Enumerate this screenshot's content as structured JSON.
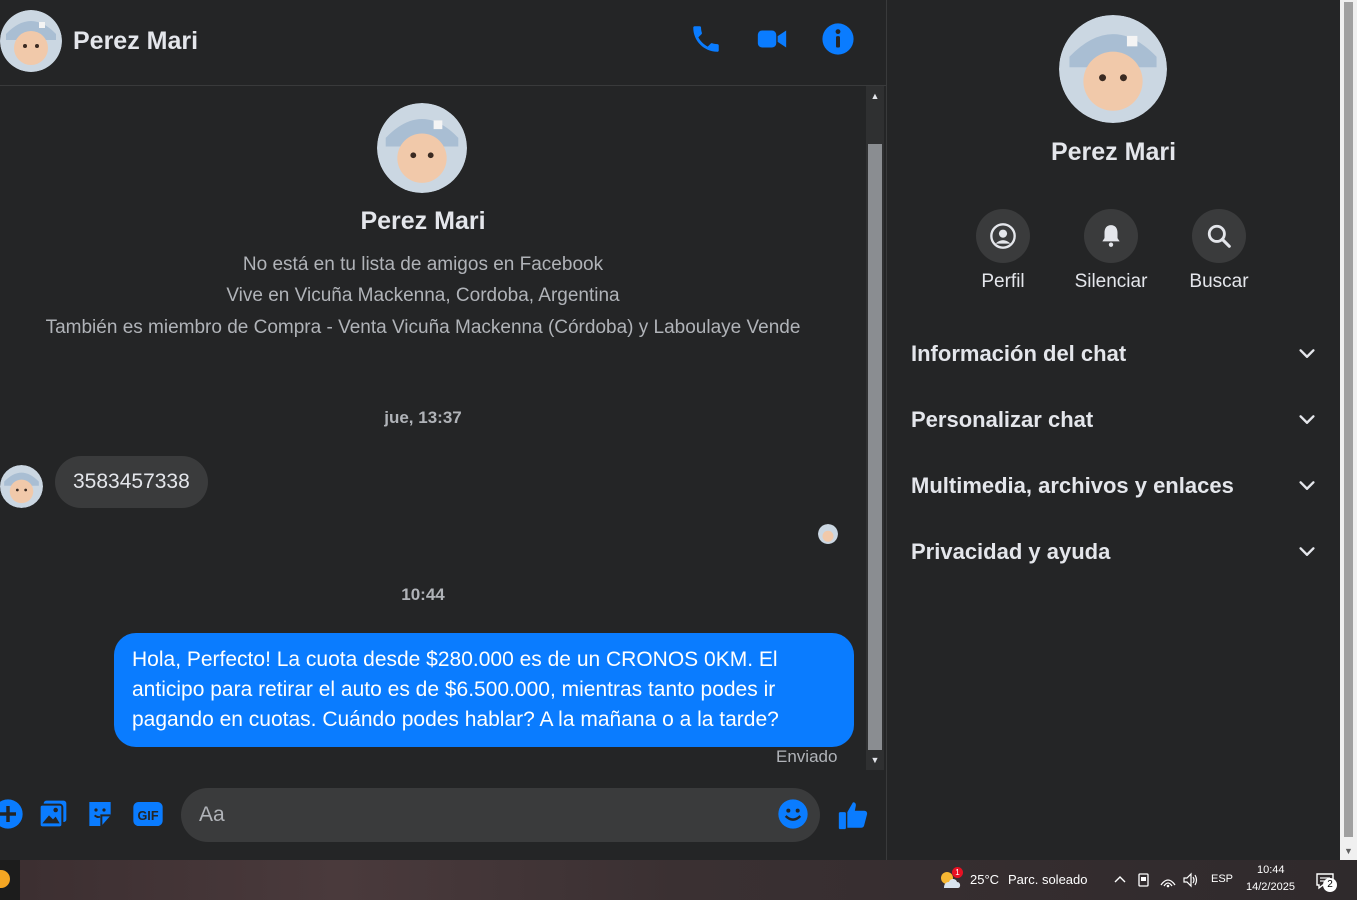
{
  "chat": {
    "contact_name": "Perez Mari",
    "intro": {
      "name": "Perez Mari",
      "line1": "No está en tu lista de amigos en Facebook",
      "line2": "Vive en Vicuña Mackenna, Cordoba, Argentina",
      "line3": "También es miembro de Compra - Venta Vicuña Mackenna (Córdoba) y Laboulaye Vende"
    },
    "messages": [
      {
        "timestamp": "jue, 13:37",
        "direction": "incoming",
        "text": "3583457338"
      },
      {
        "timestamp": "10:44",
        "direction": "outgoing",
        "text": "Hola, Perfecto! La cuota desde $280.000 es de un CRONOS 0KM. El anticipo para retirar el auto es de $6.500.000, mientras tanto podes ir pagando en cuotas. Cuándo podes hablar? A la mañana o a la tarde?",
        "status": "Enviado"
      }
    ],
    "composer": {
      "placeholder": "Aa"
    },
    "header_icons": [
      "phone-icon",
      "video-icon",
      "info-icon"
    ],
    "composer_icons": [
      "plus-icon",
      "image-icon",
      "sticker-icon",
      "gif-icon",
      "emoji-icon",
      "thumbs-up-icon"
    ],
    "gif_label": "GIF"
  },
  "info_panel": {
    "name": "Perez Mari",
    "actions": [
      {
        "label": "Perfil",
        "icon": "profile-icon"
      },
      {
        "label": "Silenciar",
        "icon": "bell-icon"
      },
      {
        "label": "Buscar",
        "icon": "search-icon"
      }
    ],
    "sections": [
      {
        "label": "Información del chat"
      },
      {
        "label": "Personalizar chat"
      },
      {
        "label": "Multimedia, archivos y enlaces"
      },
      {
        "label": "Privacidad y ayuda"
      }
    ]
  },
  "taskbar": {
    "weather_temp": "25°C",
    "weather_desc": "Parc. soleado",
    "weather_badge": "1",
    "language": "ESP",
    "time": "10:44",
    "date": "14/2/2025",
    "notifications": "2"
  },
  "colors": {
    "background": "#242526",
    "bubble_out": "#0a7cff",
    "bubble_in": "#3a3b3c",
    "accent_icon": "#0a7cff",
    "text_primary": "#e4e6eb",
    "text_secondary": "#b0b3b8"
  }
}
